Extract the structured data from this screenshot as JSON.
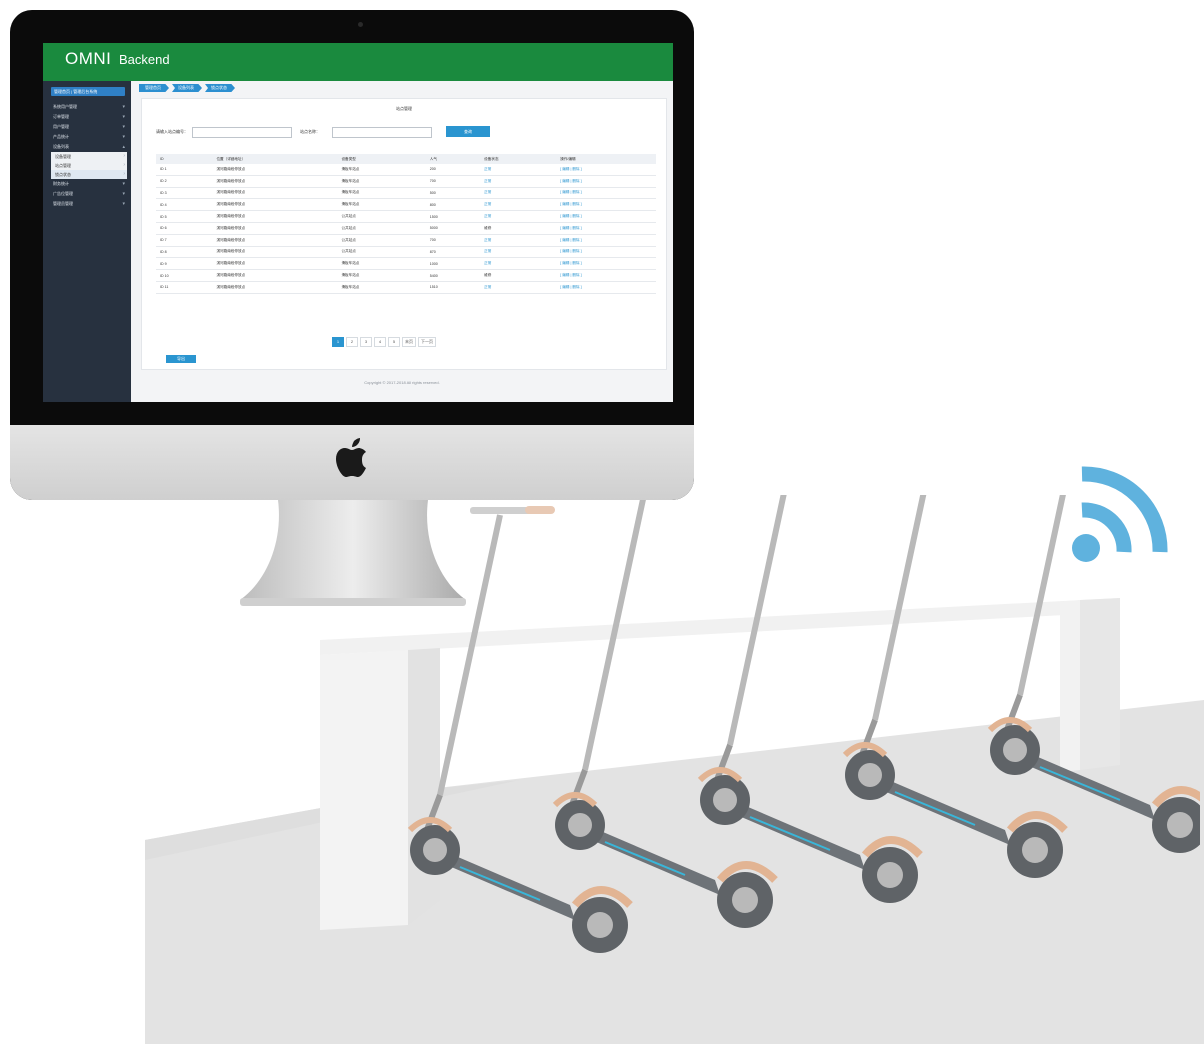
{
  "app": {
    "brand_omni": "OMNI",
    "brand_backend": "Backend",
    "brand_color": "#1a8a3e",
    "accent_color": "#2a95d0"
  },
  "sidebar": {
    "head": "管理首页 | 管理后台系统",
    "items": [
      {
        "label": "系统用户管理",
        "sub": false
      },
      {
        "label": "订单管理",
        "sub": false
      },
      {
        "label": "用户管理",
        "sub": false
      },
      {
        "label": "产品统计",
        "sub": false
      },
      {
        "label": "设备列表",
        "sub": false
      },
      {
        "label": "设备管理",
        "sub": true
      },
      {
        "label": "站点管理",
        "sub": true
      },
      {
        "label": "锁点状态",
        "sub": true
      },
      {
        "label": "财务统计",
        "sub": false
      },
      {
        "label": "广告位管理",
        "sub": false
      },
      {
        "label": "管理员管理",
        "sub": false
      }
    ]
  },
  "breadcrumbs": [
    "管理首页",
    "设备列表",
    "锁点状态"
  ],
  "panel": {
    "title": "站点管理",
    "search_label_1": "请输入站点编号：",
    "search_label_2": "站点名称：",
    "search_button": "查询"
  },
  "table": {
    "headers": [
      "ID",
      "位置（详细地址）",
      "设备类型",
      "人气",
      "设备状态",
      "操作/编辑"
    ],
    "rows": [
      {
        "id": "ID 1",
        "location": "滨河路南段停放点",
        "type": "滑板车站点",
        "pop": "200",
        "status": "正常",
        "op": "[ 编辑 | 删除 ]"
      },
      {
        "id": "ID 2",
        "location": "滨河路南段停放点",
        "type": "滑板车站点",
        "pop": "700",
        "status": "正常",
        "op": "[ 编辑 | 删除 ]"
      },
      {
        "id": "ID 3",
        "location": "滨河路南段停放点",
        "type": "滑板车站点",
        "pop": "500",
        "status": "正常",
        "op": "[ 编辑 | 删除 ]"
      },
      {
        "id": "ID 4",
        "location": "滨河路南段停放点",
        "type": "滑板车站点",
        "pop": "800",
        "status": "正常",
        "op": "[ 编辑 | 删除 ]"
      },
      {
        "id": "ID 5",
        "location": "滨河路南段停放点",
        "type": "公共站点",
        "pop": "1500",
        "status": "正常",
        "op": "[ 编辑 | 删除 ]"
      },
      {
        "id": "ID 6",
        "location": "滨河路南段停放点",
        "type": "公共站点",
        "pop": "5000",
        "status": "维修",
        "op": "[ 编辑 | 删除 ]"
      },
      {
        "id": "ID 7",
        "location": "滨河路南段停放点",
        "type": "公共站点",
        "pop": "700",
        "status": "正常",
        "op": "[ 编辑 | 删除 ]"
      },
      {
        "id": "ID 8",
        "location": "滨河路南段停放点",
        "type": "公共站点",
        "pop": "870",
        "status": "正常",
        "op": "[ 编辑 | 删除 ]"
      },
      {
        "id": "ID 9",
        "location": "滨河路南段停放点",
        "type": "滑板车站点",
        "pop": "1000",
        "status": "正常",
        "op": "[ 编辑 | 删除 ]"
      },
      {
        "id": "ID 10",
        "location": "滨河路南段停放点",
        "type": "滑板车站点",
        "pop": "5400",
        "status": "维修",
        "op": "[ 编辑 | 删除 ]"
      },
      {
        "id": "ID 11",
        "location": "滨河路南段停放点",
        "type": "滑板车站点",
        "pop": "1510",
        "status": "正常",
        "op": "[ 编辑 | 删除 ]"
      }
    ]
  },
  "pagination": {
    "pages": [
      "1",
      "2",
      "3",
      "4",
      "5"
    ],
    "current": "1",
    "last_label": "末页",
    "next_label": "下一页"
  },
  "export_button": "导出",
  "copyright": "Copyright © 2017-2018 All rights reserved."
}
